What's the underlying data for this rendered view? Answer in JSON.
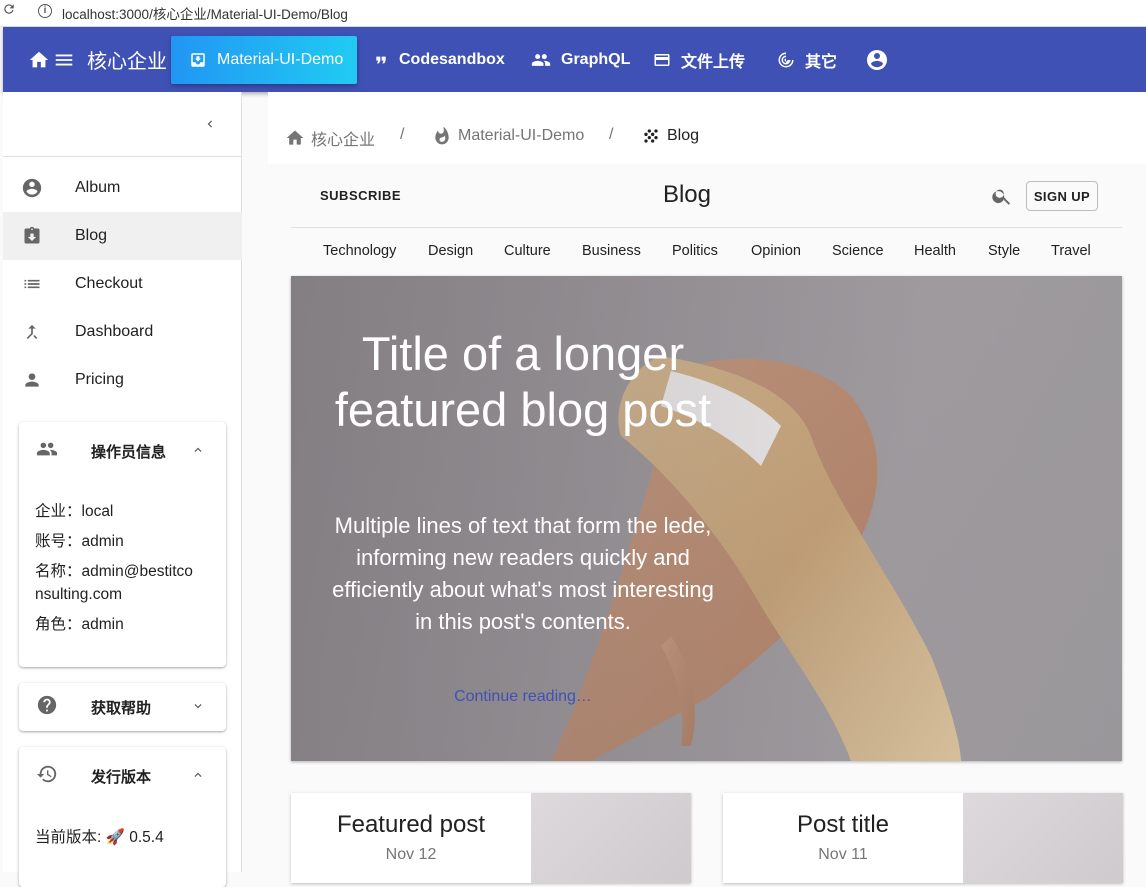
{
  "browser": {
    "url": "localhost:3000/核心企业/Material-UI-Demo/Blog"
  },
  "appbar": {
    "brand": "核心企业",
    "items": [
      {
        "label": "Material-UI-Demo",
        "icon": "inbox-icon"
      },
      {
        "label": "Codesandbox",
        "icon": "quote-icon"
      },
      {
        "label": "GraphQL",
        "icon": "people-icon"
      },
      {
        "label": "文件上传",
        "icon": "credit-card-icon"
      },
      {
        "label": "其它",
        "icon": "spiral-icon"
      }
    ],
    "colors": {
      "bar": "#3f51b5",
      "active": "#21a5f3"
    }
  },
  "sidebar": {
    "items": [
      {
        "label": "Album"
      },
      {
        "label": "Blog"
      },
      {
        "label": "Checkout"
      },
      {
        "label": "Dashboard"
      },
      {
        "label": "Pricing"
      }
    ],
    "operator": {
      "title": "操作员信息",
      "company": "企业：local",
      "account": "账号：admin",
      "name_line1": "名称：admin@bestitco",
      "name_line2": "nsulting.com",
      "role": "角色：admin"
    },
    "help": {
      "title": "获取帮助"
    },
    "release": {
      "title": "发行版本",
      "version_label": "当前版本: ",
      "rocket": "🚀",
      "version": "0.5.4"
    }
  },
  "breadcrumb": {
    "home": "核心企业",
    "demo": "Material-UI-Demo",
    "current": "Blog",
    "sep": "/"
  },
  "blog": {
    "subscribe": "SUBSCRIBE",
    "title": "Blog",
    "signup": "SIGN UP",
    "sections": [
      "Technology",
      "Design",
      "Culture",
      "Business",
      "Politics",
      "Opinion",
      "Science",
      "Health",
      "Style",
      "Travel"
    ],
    "hero": {
      "title": "Title of a longer featured blog post",
      "lede": "Multiple lines of text that form the lede, informing new readers quickly and efficiently about what's most interesting in this post's contents.",
      "link": "Continue reading…"
    },
    "posts": [
      {
        "title": "Featured post",
        "date": "Nov 12"
      },
      {
        "title": "Post title",
        "date": "Nov 11"
      }
    ]
  }
}
